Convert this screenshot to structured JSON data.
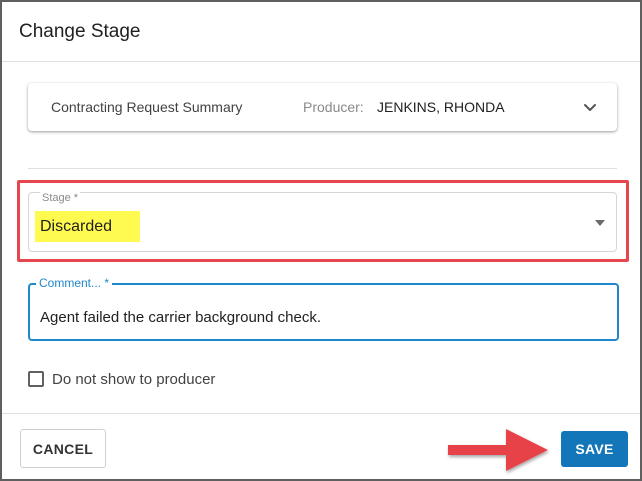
{
  "dialog": {
    "title": "Change Stage"
  },
  "summary": {
    "title": "Contracting Request Summary",
    "producer_label": "Producer:",
    "producer_value": "JENKINS, RHONDA",
    "expand_icon": "chevron-down-icon"
  },
  "stage": {
    "label": "Stage *",
    "value": "Discarded",
    "dropdown_icon": "caret-down-icon"
  },
  "comment": {
    "label": "Comment... *",
    "value": "Agent failed the carrier background check."
  },
  "checkbox": {
    "label": "Do not show to producer",
    "checked": false
  },
  "footer": {
    "cancel_label": "CANCEL",
    "save_label": "SAVE"
  },
  "colors": {
    "accent": "#1376b8",
    "focus": "#1e88c8",
    "annotation_red": "#e5474d",
    "highlight_yellow": "#fffa4f"
  }
}
